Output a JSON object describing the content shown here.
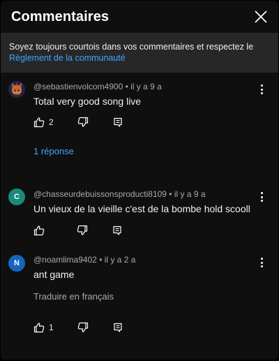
{
  "header": {
    "title": "Commentaires"
  },
  "notice": {
    "text": "Soyez toujours courtois dans vos commentaires et respectez le ",
    "link": "Règlement de la communauté"
  },
  "comments": [
    {
      "author": "@sebastienvolcom4900",
      "time": "il y a 9 a",
      "text": "Total very good song live",
      "likes": "2",
      "replies": "1 réponse",
      "avatar_letter": "",
      "avatar_color": "#3d2b6b"
    },
    {
      "author": "@chasseurdebuissonsproducti8109",
      "time": "il y a 9 a",
      "text": "Un vieux de la vieille  c'est de la bombe hold scooll",
      "likes": "",
      "avatar_letter": "C",
      "avatar_color": "#1c8a7a"
    },
    {
      "author": "@noamlima9402",
      "time": "il y a 2 a",
      "text": "ant game",
      "likes": "1",
      "translate": "Traduire en français",
      "avatar_letter": "N",
      "avatar_color": "#1565c0"
    }
  ],
  "colors": {
    "link": "#3ea6ff",
    "panel": "#0f0f0f",
    "notice_bg": "#272727"
  }
}
